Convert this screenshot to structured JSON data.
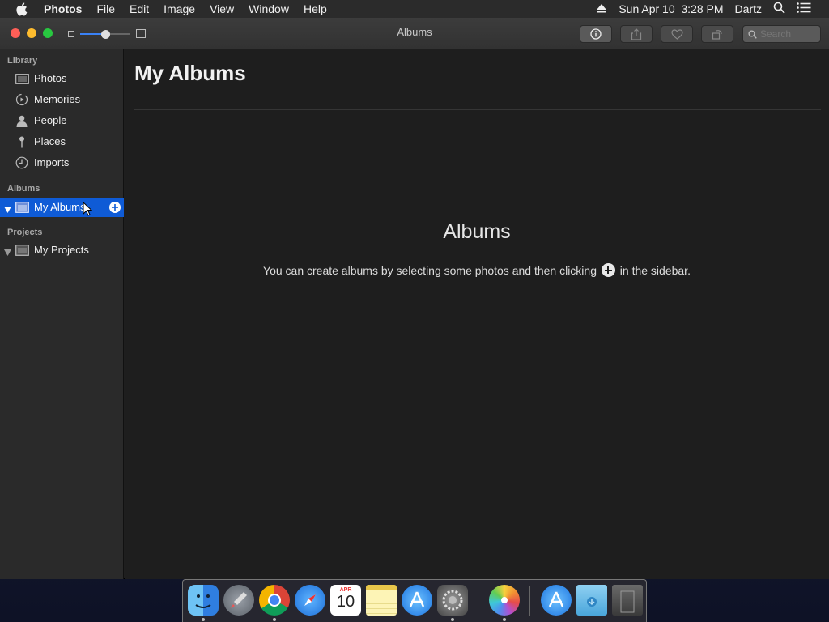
{
  "menubar": {
    "app_name": "Photos",
    "items": [
      "File",
      "Edit",
      "Image",
      "View",
      "Window",
      "Help"
    ],
    "datetime": "Sun Apr 10  3:28 PM",
    "user": "Dartz"
  },
  "window": {
    "title": "Albums",
    "search_placeholder": "Search"
  },
  "sidebar": {
    "library_header": "Library",
    "library_items": [
      {
        "label": "Photos",
        "icon": "photos-icon"
      },
      {
        "label": "Memories",
        "icon": "memories-icon"
      },
      {
        "label": "People",
        "icon": "people-icon"
      },
      {
        "label": "Places",
        "icon": "places-icon"
      },
      {
        "label": "Imports",
        "icon": "imports-icon"
      }
    ],
    "albums_header": "Albums",
    "albums_item": "My Albums",
    "projects_header": "Projects",
    "projects_item": "My Projects"
  },
  "main": {
    "title": "My Albums",
    "empty_title": "Albums",
    "empty_msg_before": "You can create albums by selecting some photos and then clicking",
    "empty_msg_after": "in the sidebar."
  },
  "dock": {
    "calendar_month": "APR",
    "calendar_day": "10",
    "apps": [
      "Finder",
      "Launchpad",
      "Chrome",
      "Safari",
      "Calendar",
      "Notes",
      "App Store",
      "System Preferences",
      "Photos",
      "App Store",
      "Downloads",
      "Trash"
    ]
  },
  "colors": {
    "selection": "#0f5bd6",
    "accent": "#3a82f7"
  }
}
